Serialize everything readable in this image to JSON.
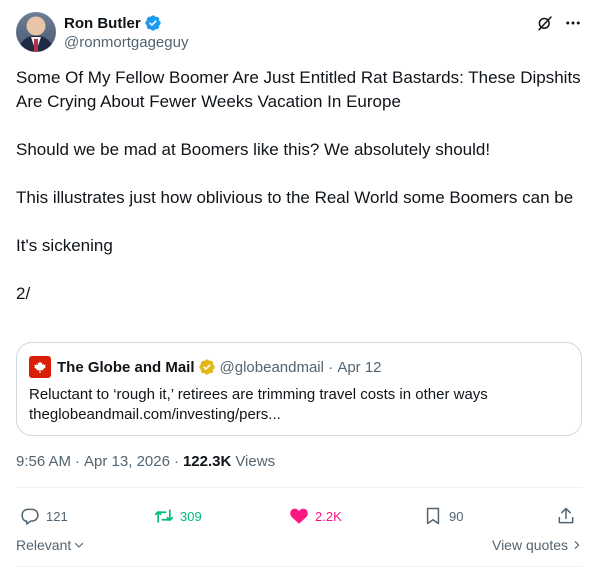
{
  "author": {
    "name": "Ron Butler",
    "handle": "@ronmortgageguy",
    "verified_color": "#1d9bf0"
  },
  "tweet": {
    "paragraphs": [
      "Some Of My Fellow Boomer Are Just Entitled Rat Bastards: These Dipshits Are Crying About Fewer Weeks Vacation In Europe",
      "Should we be mad at Boomers like this? We absolutely should!",
      "This illustrates just how oblivious to the Real World some Boomers can be",
      "It's sickening",
      "2/"
    ]
  },
  "quote": {
    "name": "The Globe and Mail",
    "handle": "@globeandmail",
    "date": "Apr 12",
    "text": "Reluctant to ‘rough it,’ retirees are trimming travel costs in other ways",
    "link": "theglobeandmail.com/investing/pers...",
    "badge_color": "#e2b719",
    "logo_color": "#d81e05"
  },
  "meta": {
    "time": "9:56 AM",
    "date": "Apr 13, 2026",
    "views_count": "122.3K",
    "views_label": "Views"
  },
  "actions": {
    "replies": "121",
    "reposts": "309",
    "likes": "2.2K",
    "bookmarks": "90"
  },
  "colors": {
    "repost": "#00ba7c",
    "like": "#f91880",
    "muted": "#536471"
  },
  "footer": {
    "sort_label": "Relevant",
    "view_quotes_label": "View quotes"
  }
}
